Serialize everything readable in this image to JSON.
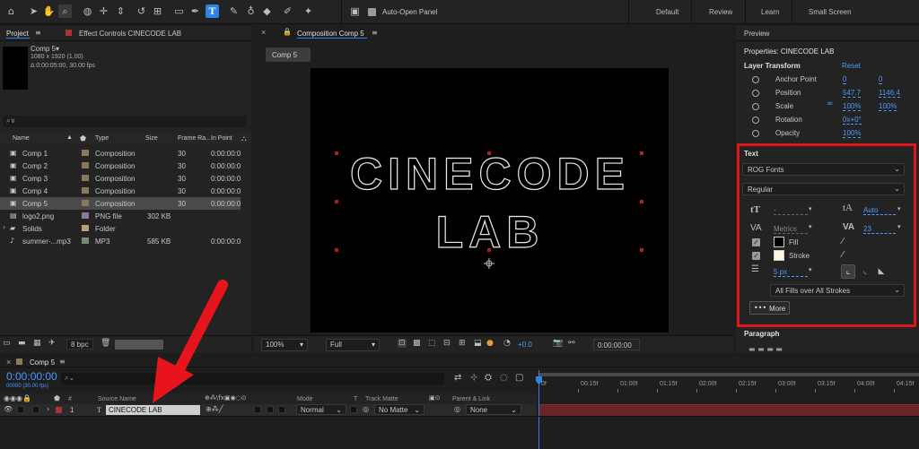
{
  "toolbar": {
    "auto_open_panel": "Auto-Open Panel",
    "workspaces": [
      "Default",
      "Review",
      "Learn",
      "Small Screen"
    ]
  },
  "project": {
    "tab_project": "Project",
    "tab_effect_controls": "Effect Controls CINECODE LAB",
    "preview_name": "Comp 5▾",
    "preview_res": "1080 x 1920 (1.00)",
    "preview_dur": "Δ 0:00:05:00, 30.00 fps",
    "search_placeholder": "⌕∨",
    "columns": [
      "Name",
      "Type",
      "Size",
      "Frame Ra...",
      "In Point"
    ],
    "items": [
      {
        "name": "Comp 1",
        "type": "Composition",
        "size": "",
        "fps": "30",
        "in": "0:00:00:0",
        "color": "#8a7a5a"
      },
      {
        "name": "Comp 2",
        "type": "Composition",
        "size": "",
        "fps": "30",
        "in": "0:00:00:0",
        "color": "#8a7a5a"
      },
      {
        "name": "Comp 3",
        "type": "Composition",
        "size": "",
        "fps": "30",
        "in": "0:00:00:0",
        "color": "#8a7a5a"
      },
      {
        "name": "Comp 4",
        "type": "Composition",
        "size": "",
        "fps": "30",
        "in": "0:00:00:0",
        "color": "#8a7a5a"
      },
      {
        "name": "Comp 5",
        "type": "Composition",
        "size": "",
        "fps": "30",
        "in": "0:00:00:0",
        "color": "#8a7a5a"
      },
      {
        "name": "logo2.png",
        "type": "PNG file",
        "size": "302 KB",
        "fps": "",
        "in": "",
        "color": "#8a7a9a"
      },
      {
        "name": "Solids",
        "type": "Folder",
        "size": "",
        "fps": "",
        "in": "",
        "color": "#b8a070"
      },
      {
        "name": "summer-...mp3",
        "type": "MP3",
        "size": "585 KB",
        "fps": "",
        "in": "0:00:00:0",
        "color": "#7a8a7a"
      }
    ],
    "bpc": "8 bpc"
  },
  "composition": {
    "tab_title": "Composition Comp 5",
    "flow_tab": "Comp 5",
    "canvas_line1": "CINECODE",
    "canvas_line2": "LAB",
    "zoom": "100%",
    "resolution": "Full",
    "exposure": "+0.0",
    "timecode": "0:00:00:00"
  },
  "properties": {
    "preview_tab": "Preview",
    "title": "Properties: CINECODE LAB",
    "layer_transform": "Layer Transform",
    "reset": "Reset",
    "rows": [
      {
        "label": "Anchor Point",
        "v1": "0",
        "v2": "0"
      },
      {
        "label": "Position",
        "v1": "547.7",
        "v2": "1146.4"
      },
      {
        "label": "Scale",
        "v1": "100%",
        "v2": "100%"
      },
      {
        "label": "Rotation",
        "v1": "0x+0°",
        "v2": ""
      },
      {
        "label": "Opacity",
        "v1": "100%",
        "v2": ""
      }
    ],
    "text_heading": "Text",
    "font": "ROG Fonts",
    "style": "Regular",
    "size_val": "-",
    "leading_val": "Auto",
    "kerning_val": "Metrics",
    "tracking_val": "23",
    "fill_label": "Fill",
    "stroke_label": "Stroke",
    "stroke_width": "5 px",
    "fill_mode": "All Fills over All Strokes",
    "more": "More",
    "paragraph": "Paragraph",
    "highlight_color": "#e0141c"
  },
  "timeline": {
    "tab": "Comp 5",
    "timecode": "0:00:00:00",
    "timecode_sub": "00000 (30.00 fps)",
    "col_source": "Source Name",
    "col_mode": "Mode",
    "col_t": "T",
    "col_track": "Track Matte",
    "col_parent": "Parent & Link",
    "layer_num": "1",
    "layer_name": "CINECODE LAB",
    "layer_mode": "Normal",
    "layer_track": "No Matte",
    "layer_parent": "None",
    "ruler": [
      "0f",
      "00:15f",
      "01:00f",
      "01:15f",
      "02:00f",
      "02:15f",
      "03:00f",
      "03:15f",
      "04:00f",
      "04:15f"
    ]
  },
  "annotation": {
    "arrow_color": "#e8141c"
  }
}
